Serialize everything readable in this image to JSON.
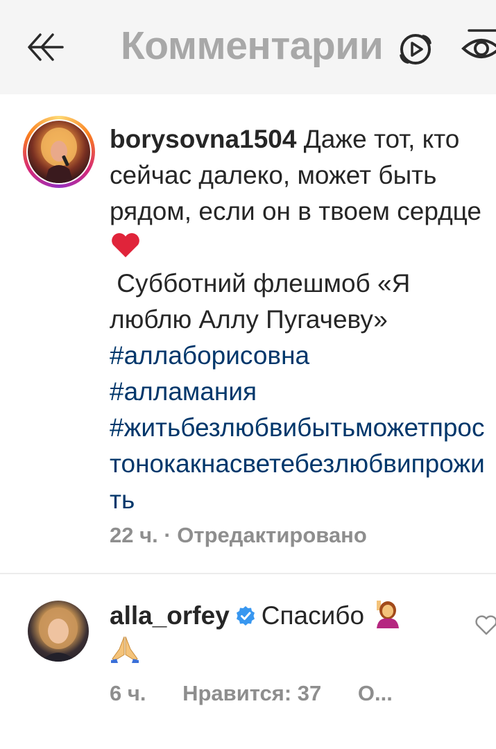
{
  "header": {
    "title": "Комментарии",
    "icons": [
      "back-icon",
      "reaction-icon",
      "eye-icon"
    ]
  },
  "comments": [
    {
      "username": "borysovna1504",
      "lines": [
        "Даже тот, кто сейчас далеко, может быть рядом, если он в твоем сердце",
        "Субботний флешмоб «Я люблю Аллу Пугачеву»"
      ],
      "emoji": "red-heart",
      "hashtags": [
        "#аллаборисовна",
        "#алламания",
        "#житьбезлюбвибытьможетпростонокакнасветебезлюбвипрожить"
      ],
      "time": "22 ч.",
      "edited": "· Отредактировано"
    },
    {
      "username": "alla_orfey",
      "verified": true,
      "text": "Спасибо",
      "emojis": [
        "person-raising-hand",
        "folded-hands"
      ],
      "time": "6 ч.",
      "likes": "Нравится: 37",
      "reply": "О..."
    }
  ],
  "colors": {
    "header_bg": "#f5f5f5",
    "title": "#a8a8a8",
    "text": "#262626",
    "hashtag": "#00376b",
    "meta": "#8e8e8e",
    "verified": "#3897f0"
  }
}
